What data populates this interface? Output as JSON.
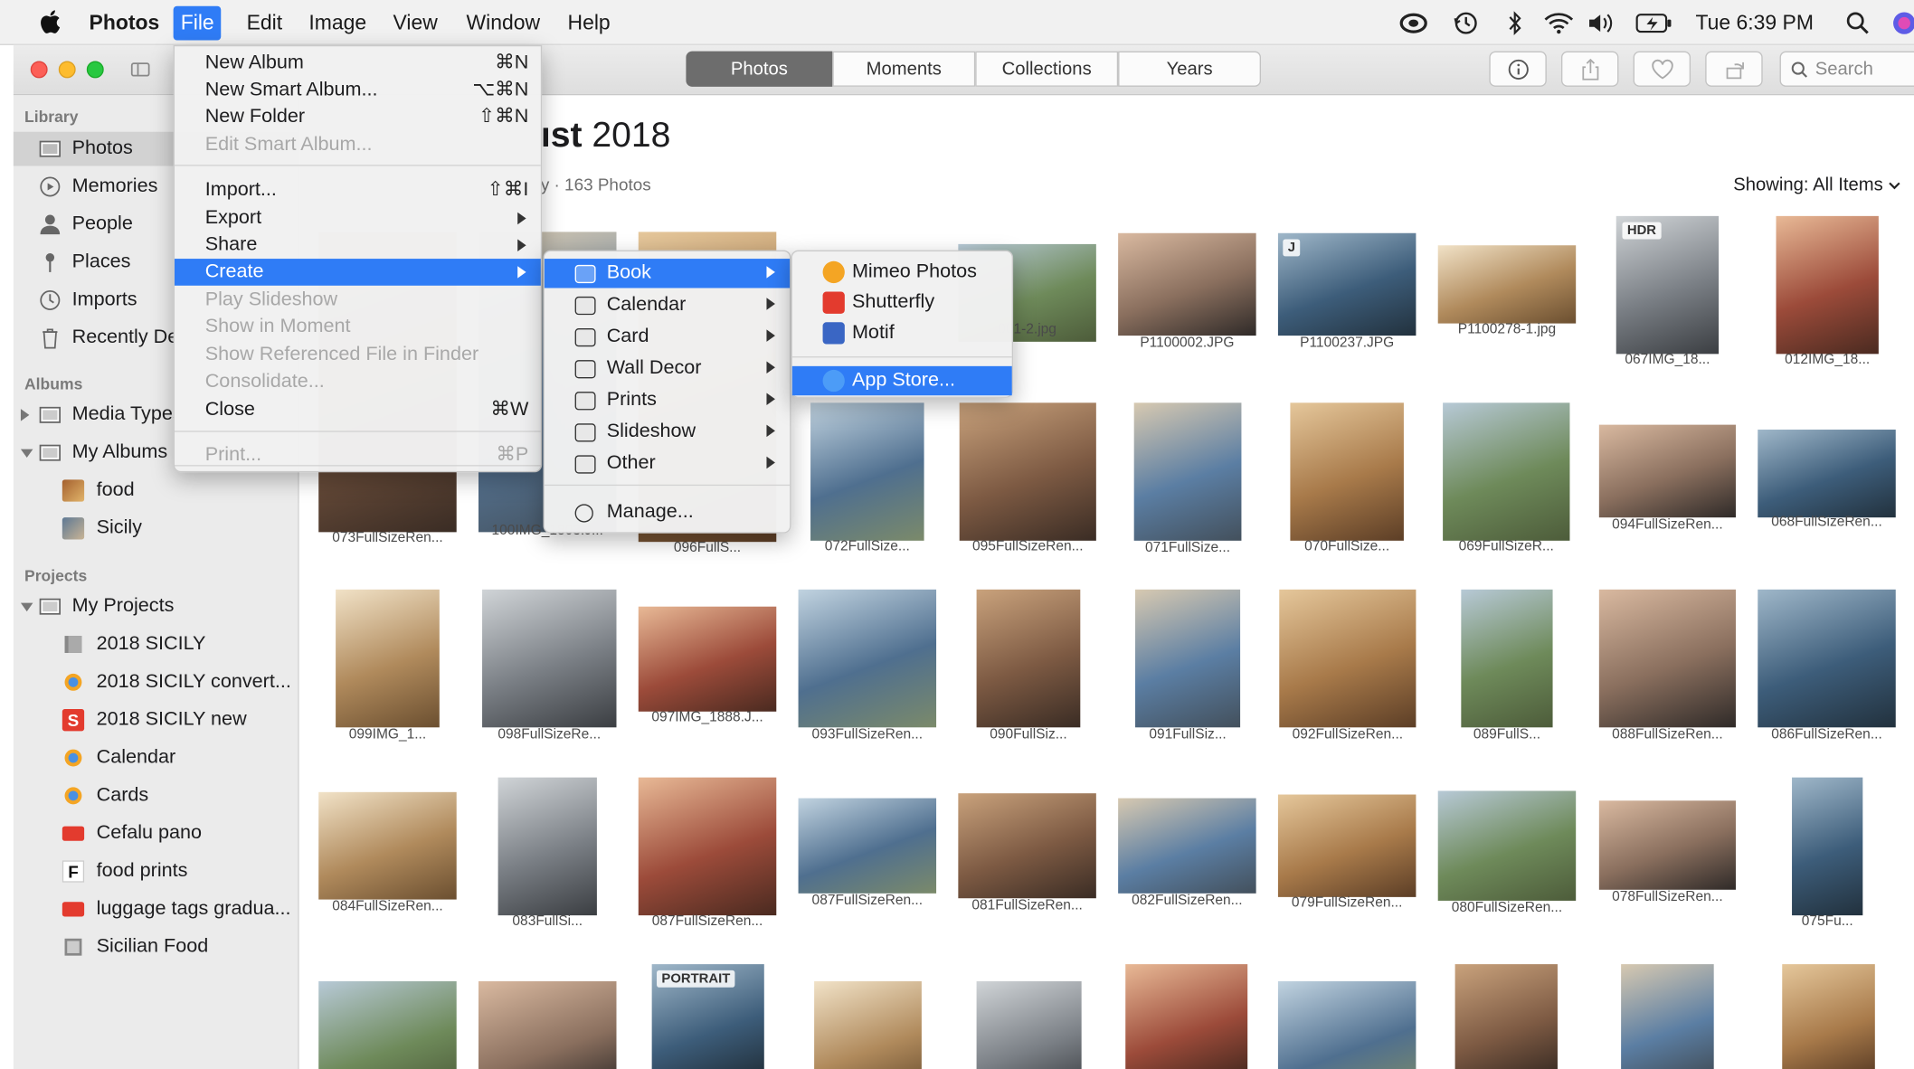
{
  "menubar": {
    "app_name": "Photos",
    "items": [
      "File",
      "Edit",
      "Image",
      "View",
      "Window",
      "Help"
    ],
    "clock": "Tue 6:39 PM"
  },
  "toolbar": {
    "tabs": [
      "Photos",
      "Moments",
      "Collections",
      "Years"
    ],
    "search_placeholder": "Search"
  },
  "sidebar": {
    "library_header": "Library",
    "library_items": [
      "Photos",
      "Memories",
      "People",
      "Places",
      "Imports",
      "Recently Deleted"
    ],
    "albums_header": "Albums",
    "albums": [
      "Media Types",
      "My Albums",
      "food",
      "Sicily"
    ],
    "projects_header": "Projects",
    "projects": [
      "My Projects",
      "2018 SICILY",
      "2018 SICILY convert...",
      "2018 SICILY new",
      "Calendar",
      "Cards",
      "Cefalu pano",
      "food prints",
      "luggage tags gradua...",
      "Sicilian Food"
    ]
  },
  "content": {
    "title_bold": "ıst",
    "title_year": "2018",
    "subtitle": "y · 163 Photos",
    "showing_label": "Showing:",
    "showing_value": "All Items"
  },
  "file_menu": {
    "items": [
      {
        "label": "New Album",
        "shortcut": "⌘N",
        "enabled": true
      },
      {
        "label": "New Smart Album...",
        "shortcut": "⌥⌘N",
        "enabled": true
      },
      {
        "label": "New Folder",
        "shortcut": "⇧⌘N",
        "enabled": true
      },
      {
        "label": "Edit Smart Album...",
        "shortcut": "",
        "enabled": false
      },
      {
        "label": "Import...",
        "shortcut": "⇧⌘I",
        "enabled": true
      },
      {
        "label": "Export",
        "shortcut": "",
        "enabled": true,
        "submenu": true
      },
      {
        "label": "Share",
        "shortcut": "",
        "enabled": true,
        "submenu": true
      },
      {
        "label": "Create",
        "shortcut": "",
        "enabled": true,
        "submenu": true,
        "highlighted": true
      },
      {
        "label": "Play Slideshow",
        "shortcut": "",
        "enabled": false
      },
      {
        "label": "Show in Moment",
        "shortcut": "",
        "enabled": false
      },
      {
        "label": "Show Referenced File in Finder",
        "shortcut": "",
        "enabled": false
      },
      {
        "label": "Consolidate...",
        "shortcut": "",
        "enabled": false
      },
      {
        "label": "Close",
        "shortcut": "⌘W",
        "enabled": true
      },
      {
        "label": "Print...",
        "shortcut": "⌘P",
        "enabled": false
      }
    ]
  },
  "create_menu": {
    "items": [
      "Book",
      "Calendar",
      "Card",
      "Wall Decor",
      "Prints",
      "Slideshow",
      "Other",
      "Manage..."
    ]
  },
  "book_menu": {
    "items": [
      "Mimeo Photos",
      "Shutterfly",
      "Motif",
      "App Store..."
    ]
  },
  "photos": {
    "badges": [
      "HDR",
      "PORTRAIT",
      "J"
    ],
    "rows": [
      [
        "073FullSizeRen...",
        "100IMG_1803.J...",
        "096FullS...",
        "001-2.jpg",
        "P1100002.JPG",
        "P1100237.JPG",
        "P1100278-1.jpg",
        "067IMG_18...",
        "012IMG_18..."
      ],
      [
        "072FullSize...",
        "095FullSizeRen...",
        "071FullSize...",
        "070FullSize...",
        "069FullSizeR...",
        "094FullSizeRen...",
        "068FullSizeRen..."
      ],
      [
        "099IMG_1...",
        "098FullSizeRe...",
        "097IMG_1888.J...",
        "093FullSizeRen...",
        "090FullSiz...",
        "091FullSiz...",
        "092FullSizeRen...",
        "089FullS...",
        "088FullSizeRen...",
        "086FullSizeRen..."
      ],
      [
        "084FullSizeRen...",
        "083FullSi...",
        "087FullSizeRen...",
        "087FullSizeRen...",
        "081FullSizeRen...",
        "082FullSizeRen...",
        "079FullSizeRen...",
        "080FullSizeRen...",
        "078FullSizeRen...",
        "075Fu..."
      ]
    ]
  },
  "colors": {
    "accent": "#2f7cf6",
    "sidebar_bg": "#ebebeb",
    "selected_segment": "#6d6d6d"
  }
}
